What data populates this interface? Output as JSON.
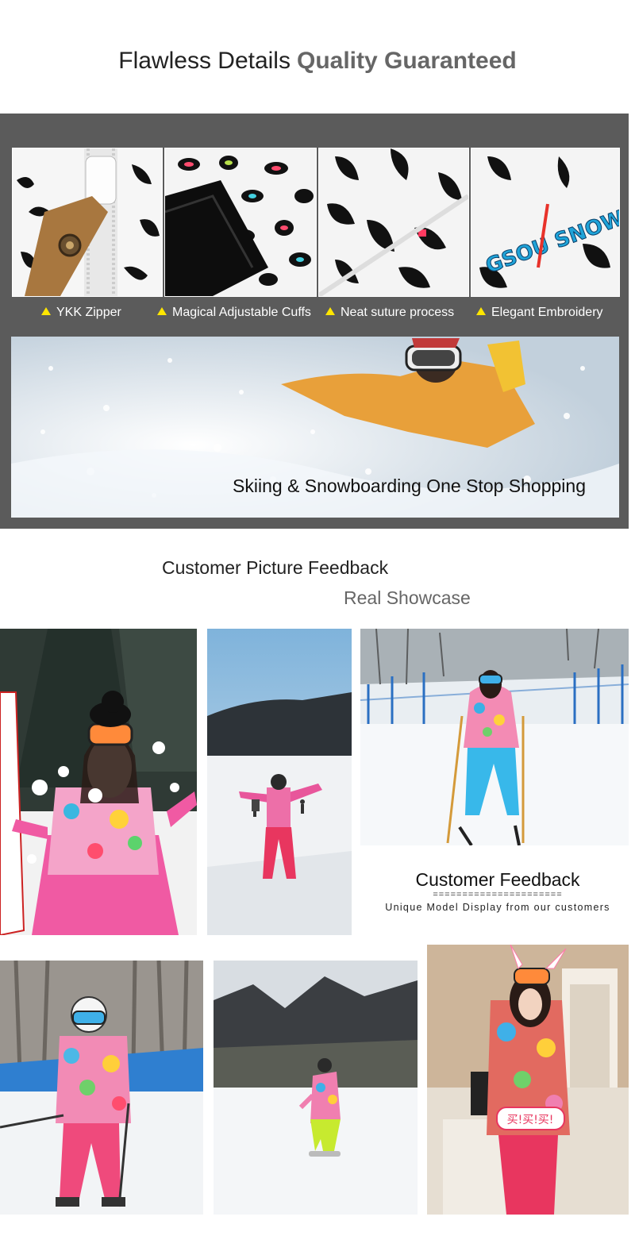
{
  "header": {
    "title_left": "Flawless Details",
    "title_right": "Quality Guaranteed"
  },
  "details": {
    "features": [
      {
        "icon": "warning-triangle-icon",
        "label": "YKK Zipper"
      },
      {
        "icon": "warning-triangle-icon",
        "label": "Magical Adjustable Cuffs"
      },
      {
        "icon": "warning-triangle-icon",
        "label": "Neat suture process"
      },
      {
        "icon": "warning-triangle-icon",
        "label": "Elegant Embroidery"
      }
    ],
    "hero_caption": "Skiing & Snowboarding One Stop Shopping",
    "embroidery_text": "GSOU SNOW"
  },
  "feedback": {
    "title": "Customer Picture Feedback",
    "subtitle": "Real Showcase",
    "box_title": "Customer Feedback",
    "box_rule": "======================",
    "box_subtitle": "Unique Model Display from our customers",
    "speech_text": "买!买!买!"
  },
  "colors": {
    "panel_bg": "#5b5b5b",
    "accent_yellow": "#ffe600",
    "jacket_pink": "#ff3c7d",
    "jacket_orange": "#e9a23b"
  }
}
